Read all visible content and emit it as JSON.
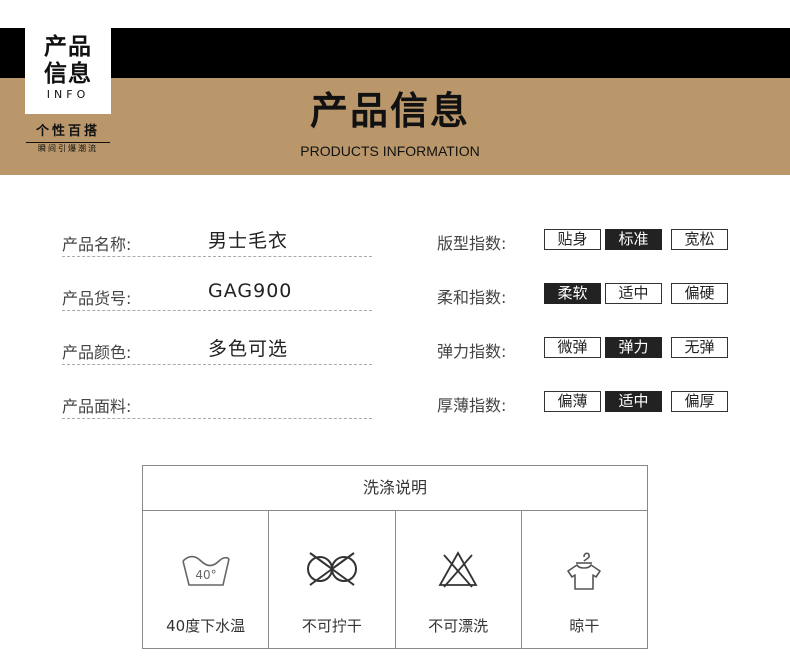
{
  "banner": {
    "logo_line1": "产品",
    "logo_line2": "信息",
    "logo_en": "INFO",
    "slogan_main": "个性百搭",
    "slogan_sub": "瞬间引爆潮流",
    "title": "产品信息",
    "subtitle": "PRODUCTS INFORMATION",
    "colors": {
      "black_band": "#000000",
      "gold_band": "#b9976b"
    }
  },
  "info": [
    {
      "label": "产品名称:",
      "value": "男士毛衣"
    },
    {
      "label": "产品货号:",
      "value": "GAG900"
    },
    {
      "label": "产品颜色:",
      "value": "多色可选"
    },
    {
      "label": "产品面料:",
      "value": ""
    }
  ],
  "indices": [
    {
      "label": "版型指数:",
      "options": [
        "贴身",
        "标准",
        "宽松"
      ],
      "selected": 1
    },
    {
      "label": "柔和指数:",
      "options": [
        "柔软",
        "适中",
        "偏硬"
      ],
      "selected": 0
    },
    {
      "label": "弹力指数:",
      "options": [
        "微弹",
        "弹力",
        "无弹"
      ],
      "selected": 1
    },
    {
      "label": "厚薄指数:",
      "options": [
        "偏薄",
        "适中",
        "偏厚"
      ],
      "selected": 1
    }
  ],
  "wash": {
    "title": "洗涤说明",
    "items": [
      {
        "icon": "wash-40-icon",
        "icon_text": "40°",
        "label": "40度下水温"
      },
      {
        "icon": "no-wring-icon",
        "label": "不可拧干"
      },
      {
        "icon": "no-bleach-icon",
        "label": "不可漂洗"
      },
      {
        "icon": "hang-dry-icon",
        "label": "晾干"
      }
    ]
  }
}
